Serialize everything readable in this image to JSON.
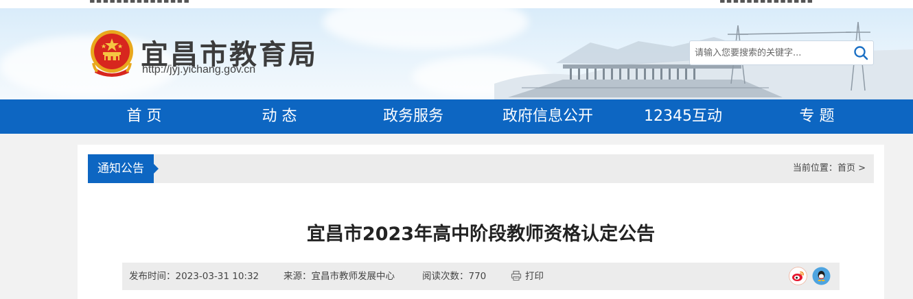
{
  "site": {
    "name": "宜昌市教育局",
    "url": "http://jyj.yichang.gov.cn"
  },
  "search": {
    "placeholder": "请输入您要搜索的关键字...",
    "icon": "search-icon"
  },
  "nav": {
    "items": [
      {
        "label": "首 页"
      },
      {
        "label": "动 态"
      },
      {
        "label": "政务服务"
      },
      {
        "label": "政府信息公开"
      },
      {
        "label": "12345互动"
      },
      {
        "label": "专 题"
      }
    ]
  },
  "section": {
    "title": "通知公告"
  },
  "breadcrumb": {
    "prefix": "当前位置：",
    "home": "首页",
    "separator": ">"
  },
  "article": {
    "title": "宜昌市2023年高中阶段教师资格认定公告",
    "publish_label": "发布时间：2023-03-31 10:32",
    "source_label": "来源：宜昌市教师发展中心",
    "views_label": "阅读次数：770",
    "print_label": "打印"
  },
  "share": {
    "weibo_icon": "weibo-icon",
    "qq_icon": "qq-icon"
  },
  "colors": {
    "nav_blue": "#0d66c2",
    "weibo": "#e6162d",
    "qq": "#4ea4e0"
  }
}
